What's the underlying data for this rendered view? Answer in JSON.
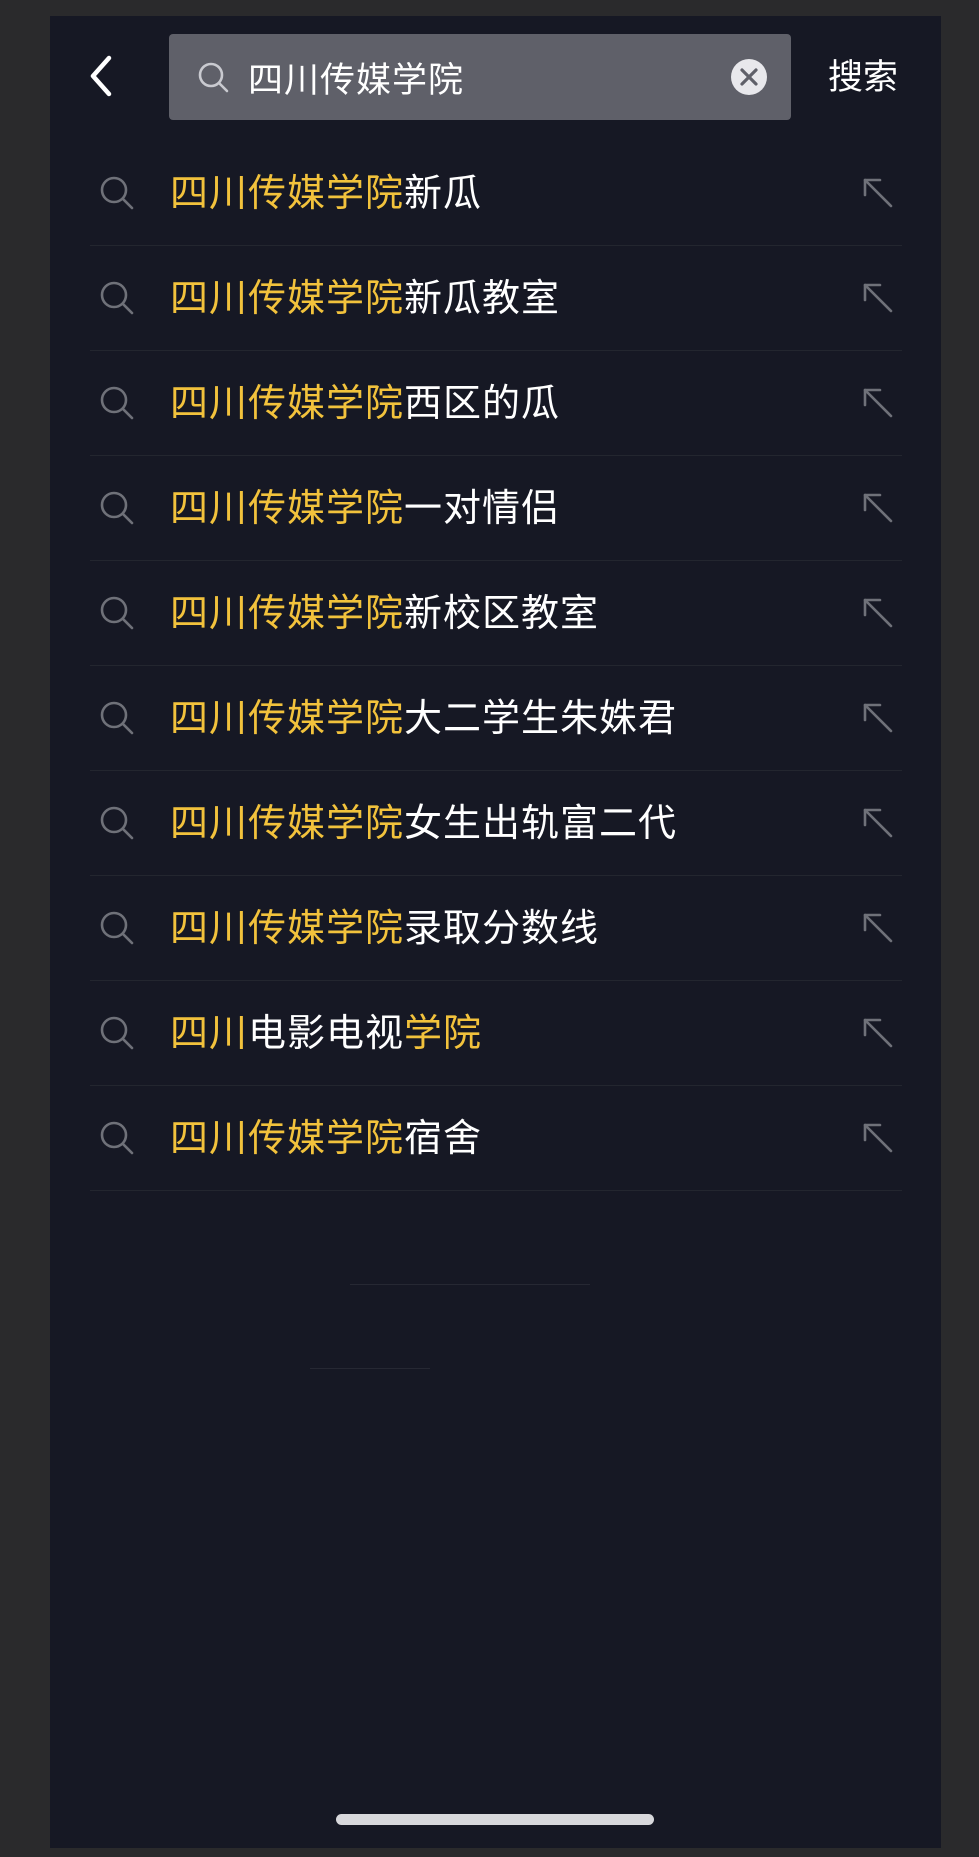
{
  "header": {
    "back_icon": "chevron-left-icon",
    "query": "四川传媒学院",
    "search_icon": "search-icon",
    "clear_icon": "clear-icon",
    "search_button": "搜索"
  },
  "colors": {
    "background": "#161824",
    "highlight": "#f2c23c",
    "text": "#ffffff",
    "search_box": "#5f6069",
    "icon": "#6f7179"
  },
  "suggestions": [
    {
      "segments": [
        {
          "text": "四川传媒学院",
          "highlight": true
        },
        {
          "text": "新瓜",
          "highlight": false
        }
      ]
    },
    {
      "segments": [
        {
          "text": "四川传媒学院",
          "highlight": true
        },
        {
          "text": "新瓜教室",
          "highlight": false
        }
      ]
    },
    {
      "segments": [
        {
          "text": "四川传媒学院",
          "highlight": true
        },
        {
          "text": "西区的瓜",
          "highlight": false
        }
      ]
    },
    {
      "segments": [
        {
          "text": "四川传媒学院",
          "highlight": true
        },
        {
          "text": "一对情侣",
          "highlight": false
        }
      ]
    },
    {
      "segments": [
        {
          "text": "四川传媒学院",
          "highlight": true
        },
        {
          "text": "新校区教室",
          "highlight": false
        }
      ]
    },
    {
      "segments": [
        {
          "text": "四川传媒学院",
          "highlight": true
        },
        {
          "text": "大二学生朱姝君",
          "highlight": false
        }
      ]
    },
    {
      "segments": [
        {
          "text": "四川传媒学院",
          "highlight": true
        },
        {
          "text": "女生出轨富二代",
          "highlight": false
        }
      ]
    },
    {
      "segments": [
        {
          "text": "四川传媒学院",
          "highlight": true
        },
        {
          "text": "录取分数线",
          "highlight": false
        }
      ]
    },
    {
      "segments": [
        {
          "text": "四川",
          "highlight": true
        },
        {
          "text": "电影电视",
          "highlight": false
        },
        {
          "text": "学院",
          "highlight": true
        }
      ]
    },
    {
      "segments": [
        {
          "text": "四川传媒学院",
          "highlight": true
        },
        {
          "text": "宿舍",
          "highlight": false
        }
      ]
    }
  ]
}
